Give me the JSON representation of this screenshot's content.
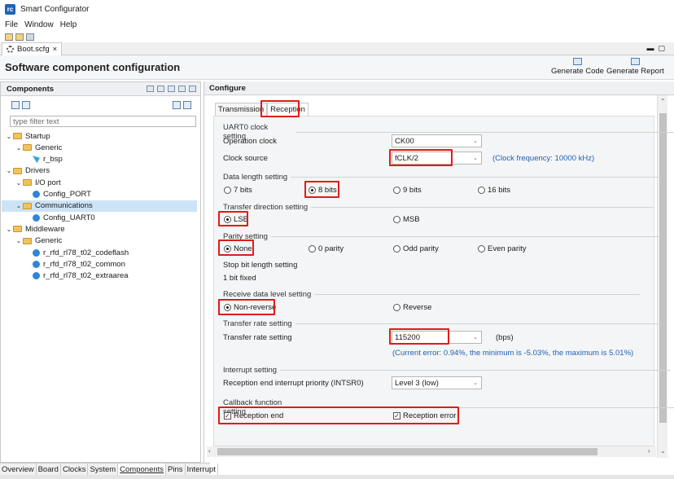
{
  "window": {
    "title": "Smart Configurator",
    "icon_text": "rc"
  },
  "menu": [
    "File",
    "Window",
    "Help"
  ],
  "editor_tab": {
    "label": "Boot.scfg",
    "close": "×"
  },
  "header": {
    "title": "Software component configuration",
    "generate_code": "Generate Code",
    "generate_report": "Generate Report"
  },
  "left": {
    "title": "Components",
    "filter_placeholder": "type filter text",
    "tree": [
      {
        "label": "Startup",
        "chev": "⌄",
        "kind": "folder",
        "indent": 0
      },
      {
        "label": "Generic",
        "chev": "⌄",
        "kind": "folder",
        "indent": 1
      },
      {
        "label": "r_bsp",
        "chev": "",
        "kind": "bsp",
        "indent": 2
      },
      {
        "label": "Drivers",
        "chev": "⌄",
        "kind": "folder",
        "indent": 0
      },
      {
        "label": "I/O port",
        "chev": "⌄",
        "kind": "folder",
        "indent": 1
      },
      {
        "label": "Config_PORT",
        "chev": "",
        "kind": "comp",
        "indent": 2
      },
      {
        "label": "Communications",
        "chev": "⌄",
        "kind": "folder",
        "indent": 1,
        "selected": true
      },
      {
        "label": "Config_UART0",
        "chev": "",
        "kind": "comp",
        "indent": 2
      },
      {
        "label": "Middleware",
        "chev": "⌄",
        "kind": "folder",
        "indent": 0
      },
      {
        "label": "Generic",
        "chev": "⌄",
        "kind": "folder",
        "indent": 1
      },
      {
        "label": "r_rfd_rl78_t02_codeflash",
        "chev": "",
        "kind": "comp",
        "indent": 2
      },
      {
        "label": "r_rfd_rl78_t02_common",
        "chev": "",
        "kind": "comp",
        "indent": 2
      },
      {
        "label": "r_rfd_rl78_t02_extraarea",
        "chev": "",
        "kind": "comp",
        "indent": 2
      }
    ]
  },
  "bottom_tabs": [
    "Overview",
    "Board",
    "Clocks",
    "System",
    "Components",
    "Pins",
    "Interrupt"
  ],
  "configure": {
    "title": "Configure",
    "tabs": [
      "Transmission",
      "Reception"
    ],
    "clock": {
      "section": "UART0 clock setting",
      "op_label": "Operation clock",
      "op_value": "CK00",
      "src_label": "Clock source",
      "src_value": "fCLK/2",
      "freq": "(Clock frequency: 10000 kHz)"
    },
    "data_length": {
      "section": "Data length setting",
      "options": [
        "7 bits",
        "8 bits",
        "9 bits",
        "16 bits"
      ]
    },
    "direction": {
      "section": "Transfer direction setting",
      "options": [
        "LSB",
        "MSB"
      ]
    },
    "parity": {
      "section": "Parity setting",
      "options": [
        "None",
        "0 parity",
        "Odd parity",
        "Even parity"
      ]
    },
    "stop": {
      "section": "Stop bit length setting",
      "value": "1 bit fixed"
    },
    "level": {
      "section": "Receive data level setting",
      "options": [
        "Non-reverse",
        "Reverse"
      ]
    },
    "rate": {
      "section": "Transfer rate setting",
      "label": "Transfer rate setting",
      "value": "115200",
      "unit": "(bps)",
      "error": "(Current error: 0.94%, the minimum is -5.03%, the maximum is 5.01%)"
    },
    "interrupt": {
      "section": "Interrupt setting",
      "label": "Reception end interrupt priority (INTSR0)",
      "value": "Level 3 (low)"
    },
    "callback": {
      "section": "Callback function setting",
      "options": [
        "Reception end",
        "Reception error"
      ]
    }
  }
}
